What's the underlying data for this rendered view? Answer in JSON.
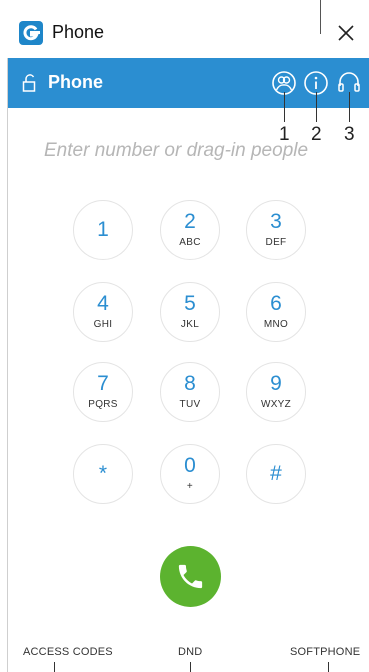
{
  "window": {
    "title": "Phone",
    "logo_letter": "G",
    "close_symbol": "✕"
  },
  "header": {
    "title": "Phone",
    "icons": [
      {
        "name": "contacts-icon",
        "callout": "1"
      },
      {
        "name": "info-icon",
        "callout": "2"
      },
      {
        "name": "headset-icon",
        "callout": "3"
      }
    ]
  },
  "dialer": {
    "placeholder": "Enter number or drag-in people",
    "keys": [
      {
        "digit": "1",
        "letters": ""
      },
      {
        "digit": "2",
        "letters": "ABC"
      },
      {
        "digit": "3",
        "letters": "DEF"
      },
      {
        "digit": "4",
        "letters": "GHI"
      },
      {
        "digit": "5",
        "letters": "JKL"
      },
      {
        "digit": "6",
        "letters": "MNO"
      },
      {
        "digit": "7",
        "letters": "PQRS"
      },
      {
        "digit": "8",
        "letters": "TUV"
      },
      {
        "digit": "9",
        "letters": "WXYZ"
      },
      {
        "digit": "*",
        "letters": ""
      },
      {
        "digit": "0",
        "letters": "+"
      },
      {
        "digit": "#",
        "letters": ""
      }
    ]
  },
  "footer": {
    "access_codes": "ACCESS CODES",
    "dnd": "DND",
    "softphone": "SOFTPHONE"
  },
  "colors": {
    "header_blue": "#2b8ed1",
    "call_green": "#5cb32f",
    "digit_blue": "#2b8ed1"
  }
}
